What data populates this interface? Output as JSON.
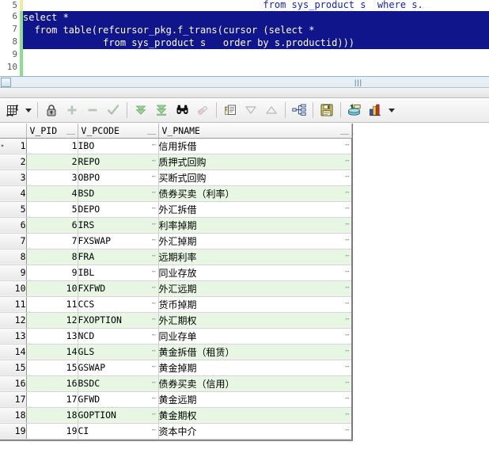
{
  "editor": {
    "line_numbers": [
      "5",
      "6",
      "7",
      "8",
      "9",
      "10"
    ],
    "lines": [
      {
        "num": "5",
        "text": "                                          from sys_product s  where s.",
        "selected": false
      },
      {
        "num": "6",
        "text": "select *",
        "selected": true
      },
      {
        "num": "7",
        "text": "  from table(refcursor_pkg.f_trans(cursor (select *",
        "selected": true
      },
      {
        "num": "8",
        "text": "              from sys_product s   order by s.productid)))",
        "selected": true
      },
      {
        "num": "9",
        "text": "",
        "selected": false
      },
      {
        "num": "10",
        "text": "",
        "selected": false
      }
    ],
    "selection_color": "#10158c",
    "text_color": "#1622c4"
  },
  "toolbar": {
    "buttons": [
      {
        "name": "grid-layout-icon",
        "title": "Grid layout"
      },
      {
        "name": "chevron-down-icon",
        "title": "Layout options"
      },
      {
        "name": "lock-icon",
        "title": "Lock"
      },
      {
        "name": "plus-icon",
        "title": "Insert row"
      },
      {
        "name": "minus-icon",
        "title": "Delete row"
      },
      {
        "name": "check-icon",
        "title": "Post changes"
      },
      {
        "name": "fetch-next-icon",
        "title": "Fetch next rows"
      },
      {
        "name": "fetch-all-icon",
        "title": "Fetch all rows"
      },
      {
        "name": "binoculars-icon",
        "title": "Find"
      },
      {
        "name": "eraser-icon",
        "title": "Clear filter"
      },
      {
        "name": "copy-icon",
        "title": "Copy to clipboard"
      },
      {
        "name": "filter-down-icon",
        "title": "Sort descending"
      },
      {
        "name": "filter-up-icon",
        "title": "Sort ascending"
      },
      {
        "name": "flow-chart-icon",
        "title": "Explain plan"
      },
      {
        "name": "save-icon",
        "title": "Export data"
      },
      {
        "name": "commit-icon",
        "title": "Commit"
      },
      {
        "name": "chart-icon",
        "title": "Chart"
      },
      {
        "name": "chart-chevron-icon",
        "title": "Chart options"
      }
    ]
  },
  "grid": {
    "columns": [
      "",
      "V_PID",
      "V_PCODE",
      "V_PNAME"
    ],
    "rows": [
      {
        "n": "1",
        "v_pid": "1",
        "v_pcode": "IBO",
        "v_pname": "信用拆借"
      },
      {
        "n": "2",
        "v_pid": "2",
        "v_pcode": "REPO",
        "v_pname": "质押式回购"
      },
      {
        "n": "3",
        "v_pid": "3",
        "v_pcode": "OBPO",
        "v_pname": "买断式回购"
      },
      {
        "n": "4",
        "v_pid": "4",
        "v_pcode": "BSD",
        "v_pname": "债券买卖（利率）"
      },
      {
        "n": "5",
        "v_pid": "5",
        "v_pcode": "DEPO",
        "v_pname": "外汇拆借"
      },
      {
        "n": "6",
        "v_pid": "6",
        "v_pcode": "IRS",
        "v_pname": "利率掉期"
      },
      {
        "n": "7",
        "v_pid": "7",
        "v_pcode": "FXSWAP",
        "v_pname": "外汇掉期"
      },
      {
        "n": "8",
        "v_pid": "8",
        "v_pcode": "FRA",
        "v_pname": "远期利率"
      },
      {
        "n": "9",
        "v_pid": "9",
        "v_pcode": "IBL",
        "v_pname": "同业存放"
      },
      {
        "n": "10",
        "v_pid": "10",
        "v_pcode": "FXFWD",
        "v_pname": "外汇远期"
      },
      {
        "n": "11",
        "v_pid": "11",
        "v_pcode": "CCS",
        "v_pname": "货币掉期"
      },
      {
        "n": "12",
        "v_pid": "12",
        "v_pcode": "FXOPTION",
        "v_pname": "外汇期权"
      },
      {
        "n": "13",
        "v_pid": "13",
        "v_pcode": "NCD",
        "v_pname": "同业存单"
      },
      {
        "n": "14",
        "v_pid": "14",
        "v_pcode": "GLS",
        "v_pname": "黄金拆借（租赁）"
      },
      {
        "n": "15",
        "v_pid": "15",
        "v_pcode": "GSWAP",
        "v_pname": "黄金掉期"
      },
      {
        "n": "16",
        "v_pid": "16",
        "v_pcode": "BSDC",
        "v_pname": "债券买卖（信用）"
      },
      {
        "n": "17",
        "v_pid": "17",
        "v_pcode": "GFWD",
        "v_pname": "黄金远期"
      },
      {
        "n": "18",
        "v_pid": "18",
        "v_pcode": "GOPTION",
        "v_pname": "黄金期权"
      },
      {
        "n": "19",
        "v_pid": "19",
        "v_pcode": "CI",
        "v_pname": "资本中介"
      }
    ],
    "cell_ellipsis": "⋯",
    "row_marker": "▸",
    "alt_row_color": "#e8f6e4",
    "row_color": "#ffffff"
  }
}
